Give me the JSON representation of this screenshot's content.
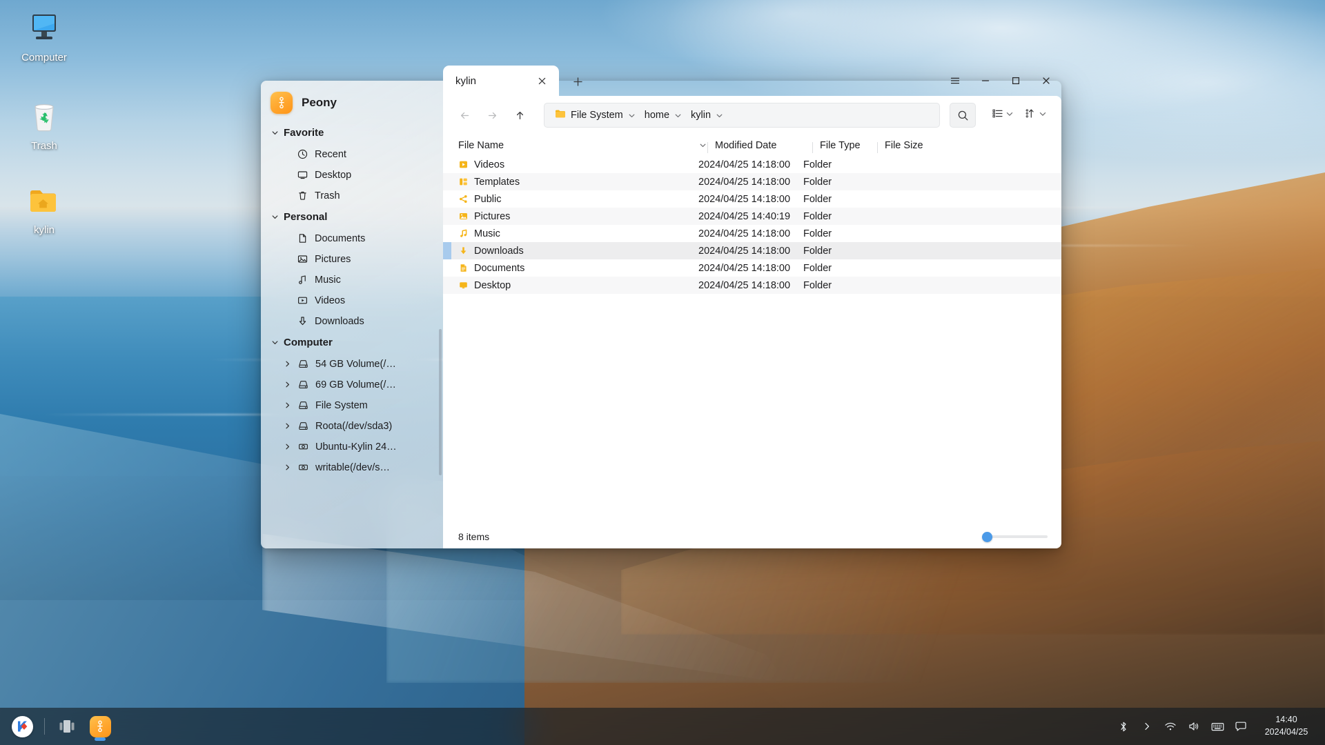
{
  "desktop": {
    "icons": [
      {
        "label": "Computer",
        "icon": "computer-icon"
      },
      {
        "label": "Trash",
        "icon": "trash-icon"
      },
      {
        "label": "kylin",
        "icon": "home-folder-icon"
      }
    ]
  },
  "window": {
    "app_name": "Peony",
    "app_logo_icon": "peony-logo-icon",
    "tabs": [
      {
        "title": "kylin",
        "close_icon": "close-icon"
      }
    ],
    "new_tab_icon": "plus-icon",
    "controls": {
      "menu_icon": "hamburger-menu-icon",
      "minimize_icon": "minimize-icon",
      "maximize_icon": "maximize-icon",
      "close_icon": "close-icon"
    },
    "toolbar": {
      "back_icon": "arrow-left-icon",
      "forward_icon": "arrow-right-icon",
      "up_icon": "arrow-up-icon",
      "search_icon": "search-icon",
      "view_mode_icon": "list-view-icon",
      "view_mode_chevron": "chevron-down-icon",
      "sort_icon": "sort-ascending-icon",
      "sort_chevron": "chevron-down-icon"
    },
    "breadcrumb": [
      {
        "label": "File System",
        "icon": "folder-icon",
        "chevron": "chevron-down-icon"
      },
      {
        "label": "home",
        "chevron": "chevron-down-icon"
      },
      {
        "label": "kylin",
        "chevron": "chevron-down-icon"
      }
    ],
    "columns": {
      "name": "File Name",
      "name_sorter_icon": "chevron-down-icon",
      "date": "Modified Date",
      "type": "File Type",
      "size": "File Size"
    },
    "files": [
      {
        "name": "Videos",
        "date": "2024/04/25 14:18:00",
        "type": "Folder",
        "size": "",
        "icon": "videos-folder-icon",
        "state": "normal"
      },
      {
        "name": "Templates",
        "date": "2024/04/25 14:18:00",
        "type": "Folder",
        "size": "",
        "icon": "templates-folder-icon",
        "state": "zebra"
      },
      {
        "name": "Public",
        "date": "2024/04/25 14:18:00",
        "type": "Folder",
        "size": "",
        "icon": "public-folder-icon",
        "state": "normal"
      },
      {
        "name": "Pictures",
        "date": "2024/04/25 14:40:19",
        "type": "Folder",
        "size": "",
        "icon": "pictures-folder-icon",
        "state": "zebra"
      },
      {
        "name": "Music",
        "date": "2024/04/25 14:18:00",
        "type": "Folder",
        "size": "",
        "icon": "music-folder-icon",
        "state": "normal"
      },
      {
        "name": "Downloads",
        "date": "2024/04/25 14:18:00",
        "type": "Folder",
        "size": "",
        "icon": "downloads-folder-icon",
        "state": "hover"
      },
      {
        "name": "Documents",
        "date": "2024/04/25 14:18:00",
        "type": "Folder",
        "size": "",
        "icon": "documents-folder-icon",
        "state": "normal"
      },
      {
        "name": "Desktop",
        "date": "2024/04/25 14:18:00",
        "type": "Folder",
        "size": "",
        "icon": "desktop-folder-icon",
        "state": "zebra"
      }
    ],
    "status": {
      "item_count": "8 items",
      "zoom_value": 12
    }
  },
  "sidebar": {
    "groups": [
      {
        "label": "Favorite",
        "expander_icon": "chevron-down-icon",
        "items": [
          {
            "label": "Recent",
            "icon": "clock-icon"
          },
          {
            "label": "Desktop",
            "icon": "monitor-icon"
          },
          {
            "label": "Trash",
            "icon": "trash-icon"
          }
        ]
      },
      {
        "label": "Personal",
        "expander_icon": "chevron-down-icon",
        "items": [
          {
            "label": "Documents",
            "icon": "document-icon"
          },
          {
            "label": "Pictures",
            "icon": "image-icon"
          },
          {
            "label": "Music",
            "icon": "note-icon"
          },
          {
            "label": "Videos",
            "icon": "video-icon"
          },
          {
            "label": "Downloads",
            "icon": "download-icon"
          }
        ]
      },
      {
        "label": "Computer",
        "expander_icon": "chevron-down-icon",
        "items": [
          {
            "label": "54 GB Volume(/…",
            "icon": "drive-icon",
            "expander_icon": "chevron-right-icon"
          },
          {
            "label": "69 GB Volume(/…",
            "icon": "drive-icon",
            "expander_icon": "chevron-right-icon"
          },
          {
            "label": "File System",
            "icon": "drive-icon",
            "expander_icon": "chevron-right-icon"
          },
          {
            "label": "Roota(/dev/sda3)",
            "icon": "drive-icon",
            "expander_icon": "chevron-right-icon"
          },
          {
            "label": "Ubuntu-Kylin 24…",
            "icon": "disc-icon",
            "expander_icon": "chevron-right-icon"
          },
          {
            "label": "writable(/dev/s…",
            "icon": "disc-icon",
            "expander_icon": "chevron-right-icon"
          }
        ]
      }
    ]
  },
  "taskbar": {
    "start_icon": "kylin-start-icon",
    "taskview_icon": "task-view-icon",
    "apps": [
      {
        "name": "Peony",
        "icon": "peony-logo-icon",
        "running": true
      }
    ],
    "tray": [
      {
        "icon": "bluetooth-icon"
      },
      {
        "icon": "chevron-right-icon"
      },
      {
        "icon": "wifi-icon"
      },
      {
        "icon": "volume-icon"
      },
      {
        "icon": "keyboard-icon"
      },
      {
        "icon": "notification-icon"
      }
    ],
    "clock": {
      "time": "14:40",
      "date": "2024/04/25"
    }
  },
  "colors": {
    "accent": "#4b9ae8",
    "folder_yellow": "#f5b51a",
    "selection": "#a8cbed",
    "taskbar_bg": "#141c22"
  }
}
